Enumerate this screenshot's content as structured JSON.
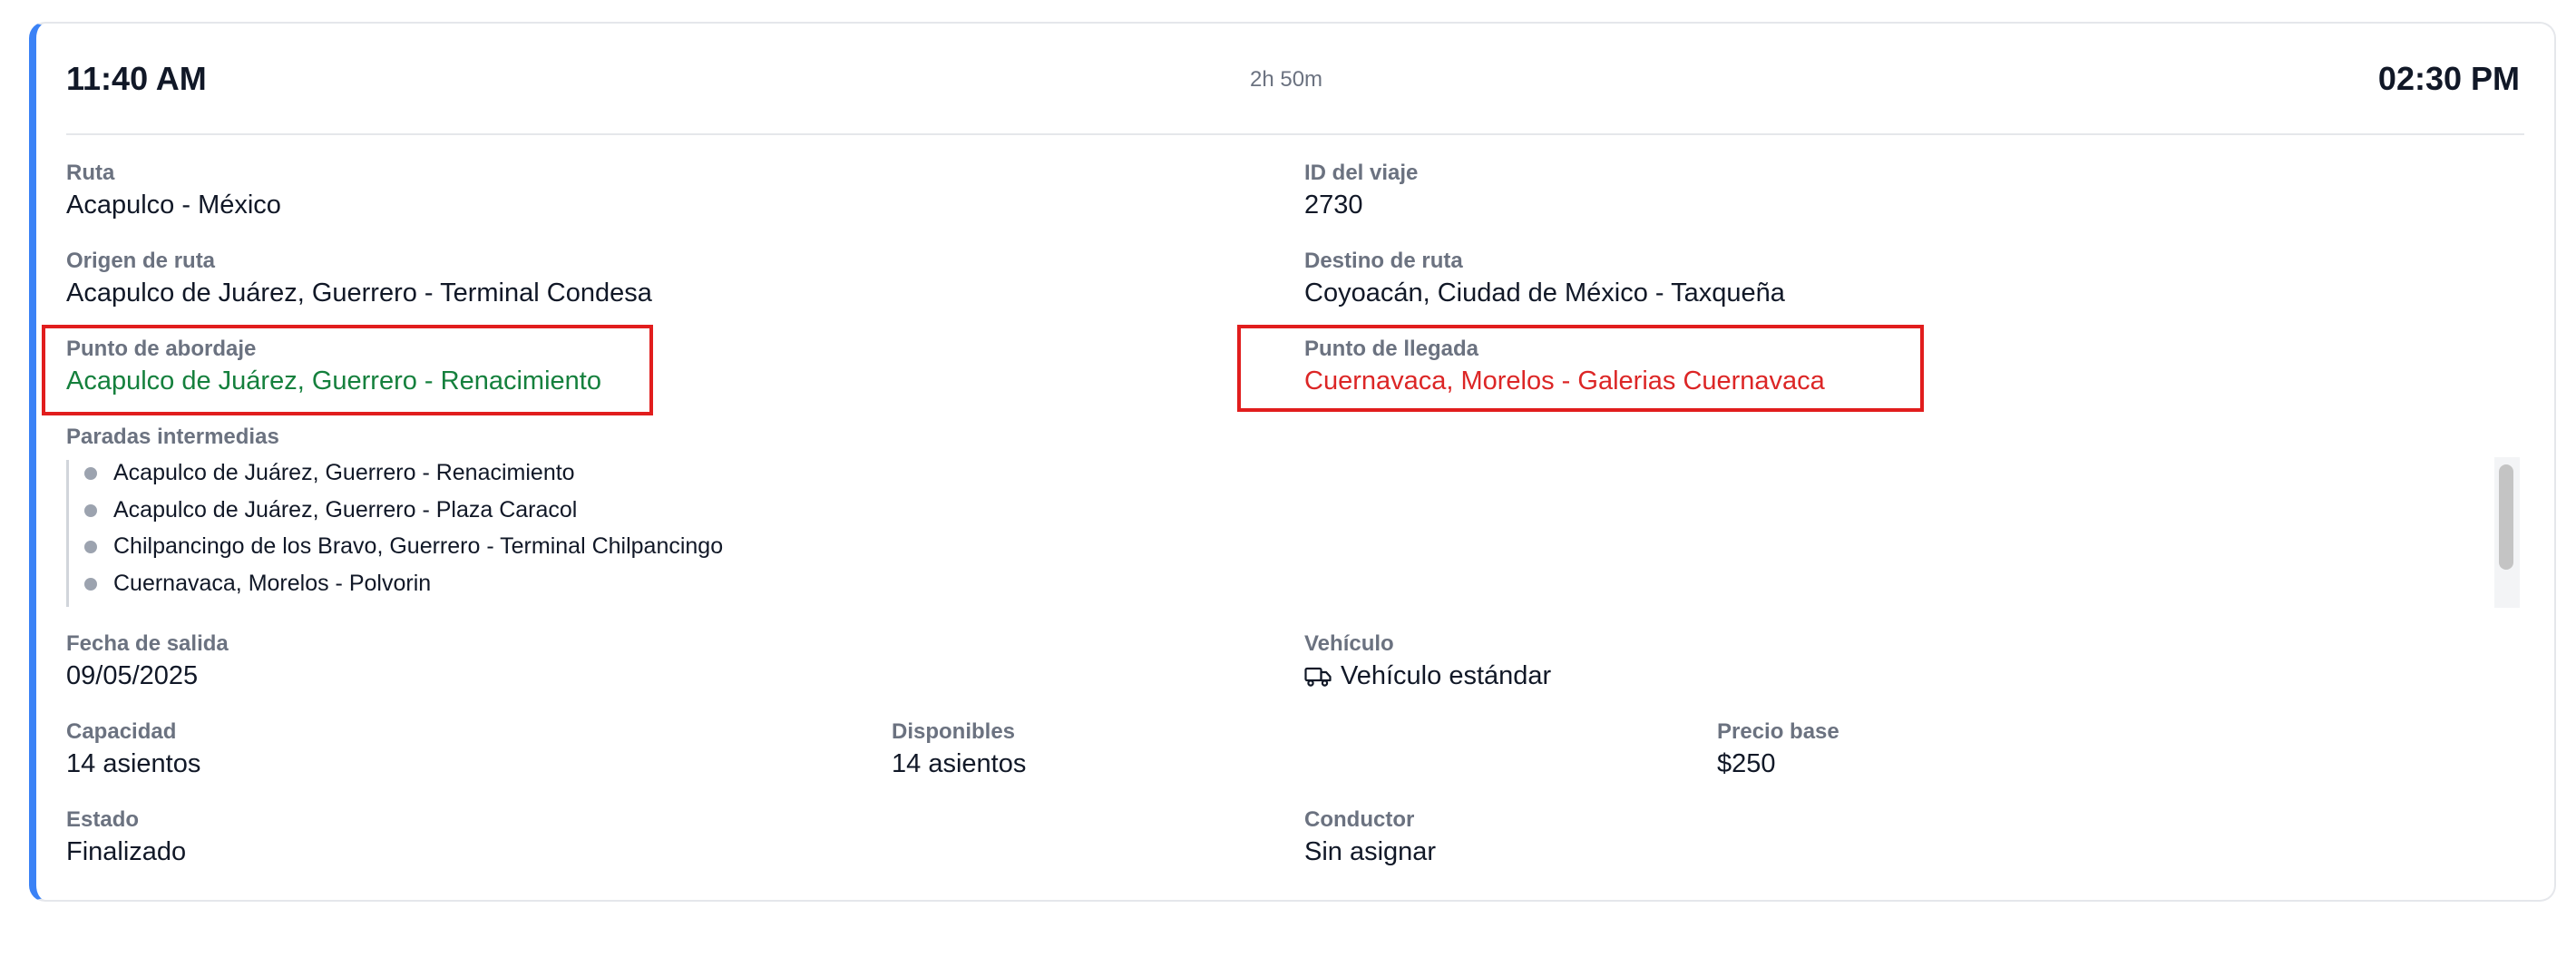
{
  "header": {
    "departure_time": "11:40 AM",
    "duration": "2h 50m",
    "arrival_time": "02:30 PM"
  },
  "fields": {
    "route_label": "Ruta",
    "route_value": "Acapulco - México",
    "trip_id_label": "ID del viaje",
    "trip_id_value": "2730",
    "route_origin_label": "Origen de ruta",
    "route_origin_value": "Acapulco de Juárez, Guerrero - Terminal Condesa",
    "route_destination_label": "Destino de ruta",
    "route_destination_value": "Coyoacán, Ciudad de México - Taxqueña",
    "boarding_point_label": "Punto de abordaje",
    "boarding_point_value": "Acapulco de Juárez, Guerrero - Renacimiento",
    "arrival_point_label": "Punto de llegada",
    "arrival_point_value": "Cuernavaca, Morelos - Galerias Cuernavaca",
    "intermediate_stops_label": "Paradas intermedias",
    "departure_date_label": "Fecha de salida",
    "departure_date_value": "09/05/2025",
    "vehicle_label": "Vehículo",
    "vehicle_value": "Vehículo estándar",
    "capacity_label": "Capacidad",
    "capacity_value": "14 asientos",
    "available_label": "Disponibles",
    "available_value": "14 asientos",
    "base_price_label": "Precio base",
    "base_price_value": "$250",
    "status_label": "Estado",
    "status_value": "Finalizado",
    "driver_label": "Conductor",
    "driver_value": "Sin asignar"
  },
  "intermediate_stops": [
    "Acapulco de Juárez, Guerrero - Renacimiento",
    "Acapulco de Juárez, Guerrero - Plaza Caracol",
    "Chilpancingo de los Bravo, Guerrero - Terminal Chilpancingo",
    "Cuernavaca, Morelos - Polvorin"
  ],
  "icons": {
    "vehicle": "truck-icon",
    "stop_bullet": "dot-icon"
  },
  "colors": {
    "accent": "#3b82f6",
    "boarding_point": "#15803d",
    "arrival_point": "#dc2626",
    "highlight_box": "#e11d1d"
  }
}
